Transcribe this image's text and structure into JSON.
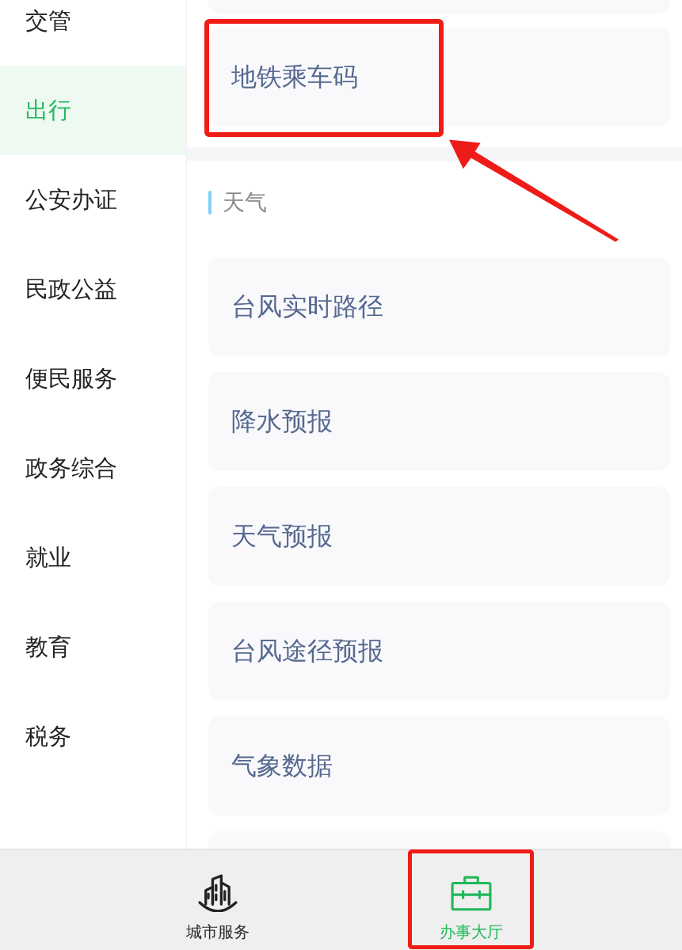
{
  "sidebar": {
    "items": [
      {
        "label": "交管",
        "selected": false
      },
      {
        "label": "出行",
        "selected": true
      },
      {
        "label": "公安办证",
        "selected": false
      },
      {
        "label": "民政公益",
        "selected": false
      },
      {
        "label": "便民服务",
        "selected": false
      },
      {
        "label": "政务综合",
        "selected": false
      },
      {
        "label": "就业",
        "selected": false
      },
      {
        "label": "教育",
        "selected": false
      },
      {
        "label": "税务",
        "selected": false
      }
    ]
  },
  "content": {
    "sections": [
      {
        "cards": [
          {
            "kind": "clipped"
          },
          {
            "kind": "service",
            "label": "地铁乘车码",
            "annotated": true,
            "arrow": true
          }
        ]
      },
      {
        "title": "天气",
        "cards": [
          {
            "kind": "service",
            "label": "台风实时路径",
            "annotated": false
          },
          {
            "kind": "service",
            "label": "降水预报",
            "annotated": false
          },
          {
            "kind": "service",
            "label": "天气预报",
            "annotated": false
          },
          {
            "kind": "service",
            "label": "台风途径预报",
            "annotated": false
          },
          {
            "kind": "service",
            "label": "气象数据",
            "annotated": false
          },
          {
            "kind": "clipped"
          }
        ]
      }
    ]
  },
  "tab_bar": {
    "tabs": [
      {
        "label": "城市服务",
        "selected": false,
        "annotated": false
      },
      {
        "label": "办事大厅",
        "selected": true,
        "annotated": true
      }
    ]
  }
}
